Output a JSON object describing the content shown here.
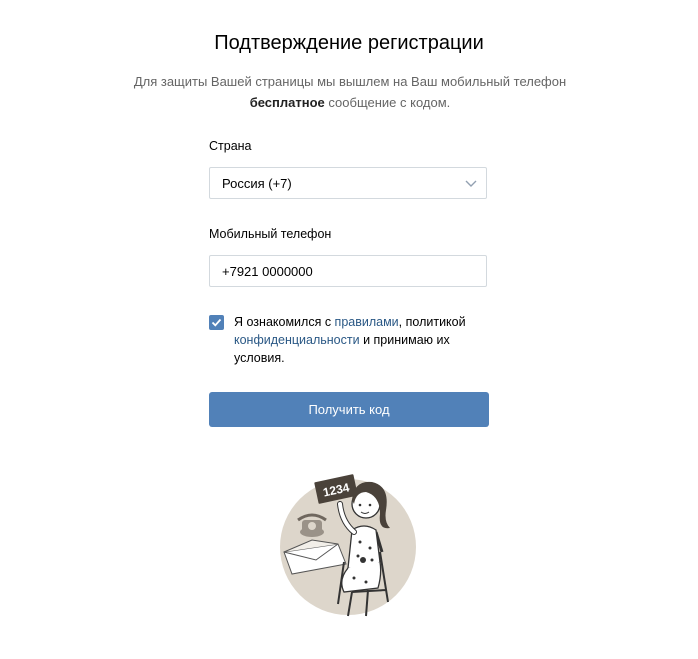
{
  "header": {
    "title": "Подтверждение регистрации",
    "subtitle_part1": "Для защиты Вашей страницы мы вышлем на Ваш мобильный телефон ",
    "subtitle_bold": "бесплатное",
    "subtitle_part2": " сообщение с кодом."
  },
  "form": {
    "country_label": "Страна",
    "country_value": "Россия (+7)",
    "phone_label": "Мобильный телефон",
    "phone_value": "+7921 0000000",
    "agree_checked": true,
    "agree_text_1": "Я ознакомился с ",
    "agree_link_rules": "правилами",
    "agree_text_2": ", политикой ",
    "agree_link_privacy": "конфиденциальности",
    "agree_text_3": " и принимаю их условия.",
    "submit_label": "Получить код"
  },
  "illustration": {
    "sign_text": "1234",
    "icon": "woman-holding-code-sign-illustration"
  },
  "colors": {
    "accent": "#5181b8",
    "link": "#2a5885",
    "border": "#d3d9de",
    "muted_text": "#656565"
  }
}
